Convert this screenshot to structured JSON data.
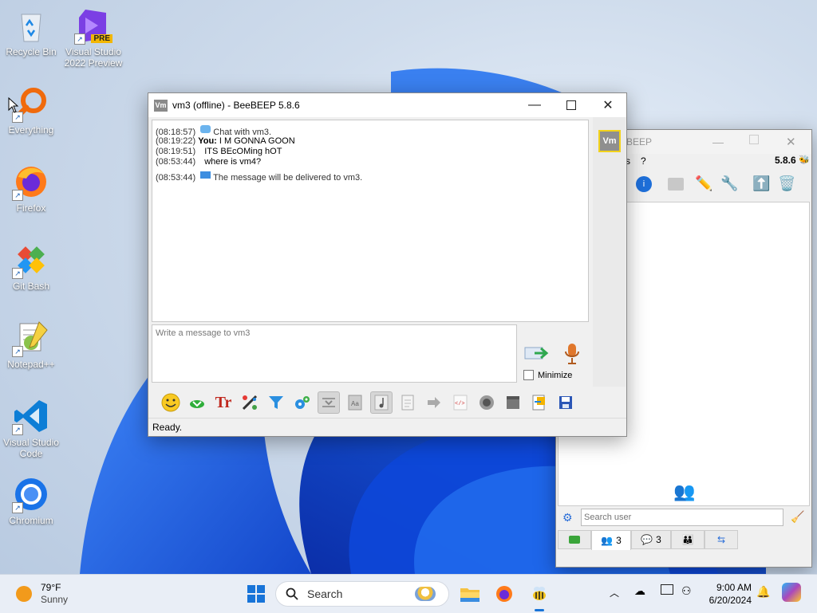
{
  "desktop": {
    "icons": [
      {
        "label": "Recycle Bin",
        "icon": "recycle-bin-icon"
      },
      {
        "label": "Visual Studio 2022 Preview",
        "icon": "visual-studio-preview-icon",
        "badge": "PRE"
      },
      {
        "label": "Everything",
        "icon": "everything-search-icon"
      },
      {
        "label": "Firefox",
        "icon": "firefox-icon"
      },
      {
        "label": "Git Bash",
        "icon": "git-bash-icon"
      },
      {
        "label": "Notepad++",
        "icon": "notepad-plus-plus-icon"
      },
      {
        "label": "Visual Studio Code",
        "icon": "vscode-icon"
      },
      {
        "label": "Chromium",
        "icon": "chromium-icon"
      }
    ]
  },
  "chat_window": {
    "title": "vm3 (offline) - BeeBEEP 5.8.6",
    "app_icon_text": "Vm",
    "avatar_text": "Vm",
    "messages": [
      {
        "time": "(08:18:57)",
        "sender": "",
        "text": "Chat with vm3.",
        "icon": "chat-bubble-icon"
      },
      {
        "time": "(08:19:22)",
        "sender": "You:",
        "text": "I M GONNA GOON"
      },
      {
        "time": "(08:19:51)",
        "sender": "",
        "text": "ITS BEcOMing hOT"
      },
      {
        "time": "(08:53:44)",
        "sender": "",
        "text": "where is vm4?"
      },
      {
        "time": "(08:53:44)",
        "sender": "",
        "text": "The message will be delivered to vm3.",
        "icon": "envelope-icon"
      }
    ],
    "input_placeholder": "Write a message to vm3",
    "minimize_label": "Minimize",
    "status": "Ready."
  },
  "main_window": {
    "title_partial": "BEEP",
    "menu_partial": "s",
    "menu_help": "?",
    "version": "5.8.6",
    "search_placeholder": "Search user",
    "tabs": [
      {
        "icon": "chat-tab-icon",
        "count": ""
      },
      {
        "icon": "users-tab-icon",
        "count": "3"
      },
      {
        "icon": "chats-tab-icon",
        "count": "3"
      },
      {
        "icon": "groups-tab-icon",
        "count": ""
      },
      {
        "icon": "files-tab-icon",
        "count": ""
      }
    ]
  },
  "taskbar": {
    "weather_temp": "79°F",
    "weather_desc": "Sunny",
    "search_label": "Search",
    "time": "9:00 AM",
    "date": "6/20/2024"
  }
}
